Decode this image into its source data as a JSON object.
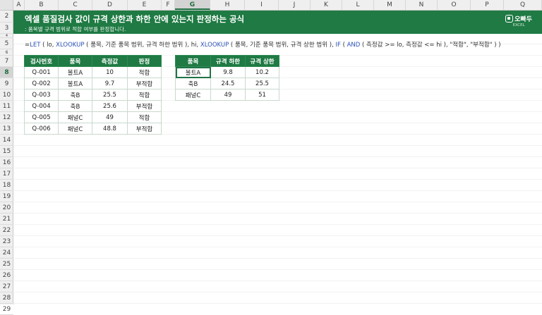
{
  "columns": [
    "A",
    "B",
    "C",
    "D",
    "E",
    "F",
    "G",
    "H",
    "I",
    "J",
    "K",
    "L",
    "M",
    "N",
    "O",
    "P",
    "Q"
  ],
  "rows": [
    "2",
    "3",
    "4",
    "5",
    "6",
    "7",
    "8",
    "9",
    "10",
    "11",
    "12",
    "13",
    "14",
    "15",
    "16",
    "17",
    "18",
    "19",
    "20",
    "21",
    "22",
    "23",
    "24",
    "25",
    "26",
    "27",
    "28",
    "29"
  ],
  "banner": {
    "title": "엑셀 품질검사 값이 규격 상한과 하한 안에 있는지 판정하는 공식",
    "subtitle": ": 품목별 규격 범위로 적합 여부를 판정합니다.",
    "logo": "오빠두",
    "logo_small": "EXCEL"
  },
  "formula": {
    "p1": "=",
    "f1": "LET",
    "p2": " ( lo, ",
    "f2": "XLOOKUP",
    "p3": " ( 품목, 기준 품목 범위, 규격 하한 범위 ), hi, ",
    "f3": "XLOOKUP",
    "p4": " ( 품목, 기준 품목 범위, 규격 상한 범위 ), ",
    "f4": "IF",
    "p5": " ( ",
    "f5": "AND",
    "p6": " ( 측정값 >= lo, 측정값 <= hi ), \"적합\", \"부적합\" ) )"
  },
  "left_table": {
    "headers": [
      "검사번호",
      "품목",
      "측정값",
      "판정"
    ],
    "rows": [
      [
        "Q-001",
        "볼트A",
        "10",
        "적합"
      ],
      [
        "Q-002",
        "볼트A",
        "9.7",
        "부적합"
      ],
      [
        "Q-003",
        "축B",
        "25.5",
        "적합"
      ],
      [
        "Q-004",
        "축B",
        "25.6",
        "부적합"
      ],
      [
        "Q-005",
        "패널C",
        "49",
        "적합"
      ],
      [
        "Q-006",
        "패널C",
        "48.8",
        "부적합"
      ]
    ]
  },
  "right_table": {
    "headers": [
      "품목",
      "규격 하한",
      "규격 상한"
    ],
    "rows": [
      [
        "볼트A",
        "9.8",
        "10.2"
      ],
      [
        "축B",
        "24.5",
        "25.5"
      ],
      [
        "패널C",
        "49",
        "51"
      ]
    ]
  },
  "colors": {
    "header_green": "#1f7a43",
    "formula_function": "#2d53b8"
  }
}
